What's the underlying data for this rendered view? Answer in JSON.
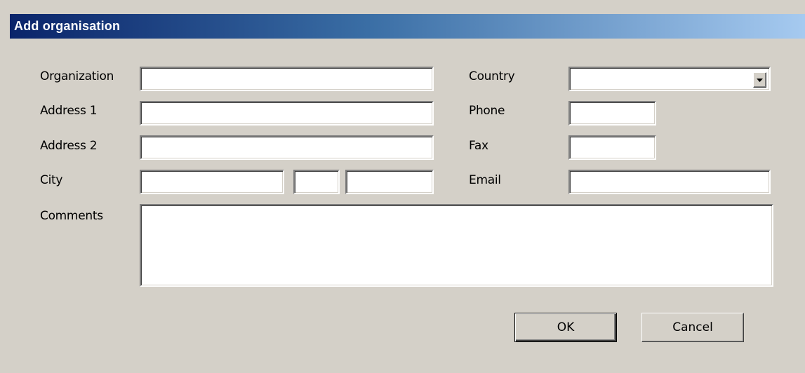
{
  "window": {
    "title": "Add organisation"
  },
  "form": {
    "organization_label": "Organization",
    "address1_label": "Address 1",
    "address2_label": "Address 2",
    "city_label": "City",
    "comments_label": "Comments",
    "country_label": "Country",
    "phone_label": "Phone",
    "fax_label": "Fax",
    "email_label": "Email",
    "organization_value": "",
    "address1_value": "",
    "address2_value": "",
    "city_value": "",
    "state_value": "",
    "zip_value": "",
    "country_value": "",
    "phone_value": "",
    "fax_value": "",
    "email_value": "",
    "comments_value": ""
  },
  "buttons": {
    "ok_label": "OK",
    "cancel_label": "Cancel"
  },
  "icons": {
    "dropdown": "chevron-down-icon"
  },
  "colors": {
    "dialog_bg": "#d4d0c8",
    "title_start": "#0a246a",
    "title_end": "#a6caf0"
  }
}
